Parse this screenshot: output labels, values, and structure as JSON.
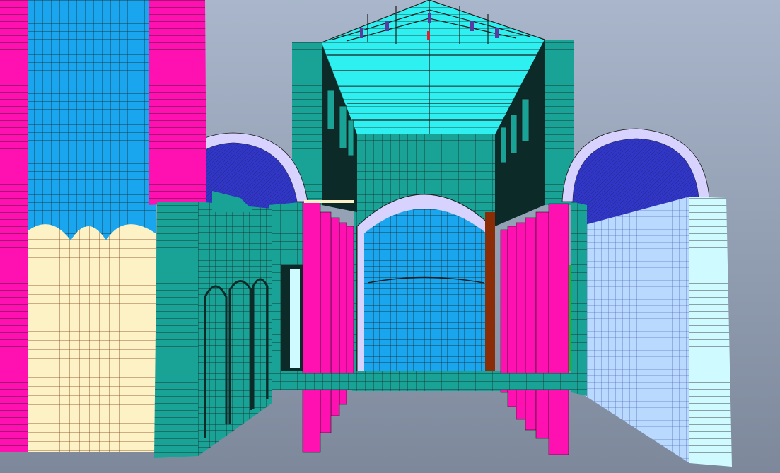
{
  "viewport": {
    "kind": "3D finite-element mesh viewport",
    "background_top": "#a9b6cb",
    "background_bottom": "#7d889b"
  },
  "palette": {
    "magenta": "#ff10b0",
    "blue": "#1aa6ee",
    "cream": "#fdf2c6",
    "teal": "#18a396",
    "cyan": "#2ff0f0",
    "lavender": "#d8d2ff",
    "vault_blue": "#3036c8",
    "dark_interior": "#0b2a28",
    "pale_blue_wall": "#b9d9ff",
    "light_cyan_slab": "#cffaff",
    "brown": "#8a2c06",
    "green": "#1bb81b",
    "mesh_line": "#1c1c1c"
  },
  "components": [
    "bell-tower",
    "left-aisle-wall",
    "left-arch-vault",
    "nave-roof-truss",
    "nave-back-wall",
    "apse-dome",
    "left-colonnade",
    "right-colonnade",
    "right-arch-vault",
    "right-aisle-wall",
    "floor-sill"
  ]
}
